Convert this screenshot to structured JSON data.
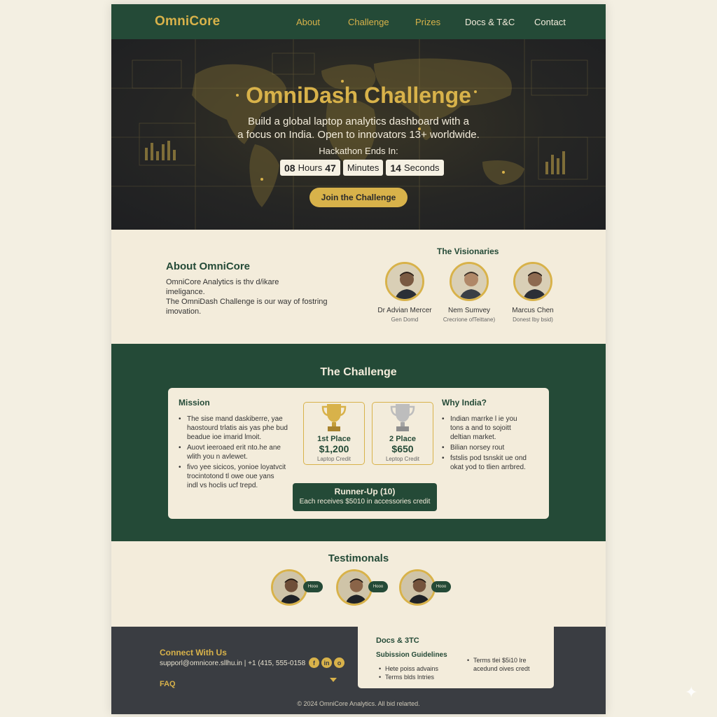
{
  "nav": {
    "logo": "OmniCore",
    "links": [
      {
        "label": "About"
      },
      {
        "label": "Challenge"
      },
      {
        "label": "Prizes"
      },
      {
        "label": "Docs & T&C"
      },
      {
        "label": "Contact"
      }
    ]
  },
  "hero": {
    "title": "OmniDash Challenge",
    "subtitle_line1": "Build a global laptop analytics dashboard with a",
    "subtitle_line2": "a focus on India. Open to innovators 13+ worldwide.",
    "ends_label": "Hackathon Ends In:",
    "countdown": {
      "hours_value": "08",
      "hours_unit": "Hours",
      "minutes_value": "47",
      "minutes_unit": "Minutes",
      "seconds_value": "14",
      "seconds_unit": "Seconds"
    },
    "cta": "Join the Challenge"
  },
  "about": {
    "title": "About OmniCore",
    "text_line1": "OmniCore Analytics is thv d/ikare",
    "text_line2": "imeligance.",
    "text_line3": "The OmniDash Challenge is our way of fostring",
    "text_line4": "imovation.",
    "visionaries_title": "The Visionaries",
    "visionaries": [
      {
        "name": "Dr Advian Mercer",
        "role": "Gen Domd"
      },
      {
        "name": "Nem Sumvey",
        "role": "Crecrione ofTeittane)"
      },
      {
        "name": "Marcus Chen",
        "role": "Donest Iby bsid)"
      }
    ]
  },
  "challenge": {
    "title": "The Challenge",
    "mission_title": "Mission",
    "mission_bullets": [
      [
        "The sise mand daskiberre, yae",
        "haostourd trlatis ais yas phe bud",
        "beadue ioe imarid lmoit."
      ],
      [
        "Auovt ieeroaed erit nto.he ane",
        "wlith you n avlewet."
      ],
      [
        "fivo yee sicicos, yonioe loyatvcit",
        "trocintotond tl owe oue yans",
        "indl vs hoclis ucf trepd."
      ]
    ],
    "prizes": [
      {
        "place": "1st Place",
        "amount": "$1,200",
        "credit": "Laptop Credit",
        "color": "#d8b24a"
      },
      {
        "place": "2 Place",
        "amount": "$650",
        "credit": "Leptop Credit",
        "color": "#b8b8b8"
      }
    ],
    "why_title": "Why India?",
    "why_bullets": [
      [
        "Indian marrke l ie you",
        "tons a and to sojoitt",
        "deltian market."
      ],
      [
        "Bilian norsey rout"
      ],
      [
        "fstslis pod tsnskit ue ond",
        "okat yod to tlien arrbred."
      ]
    ],
    "runner_title": "Runner-Up (10)",
    "runner_desc": "Each receives $5010 in accessories credit"
  },
  "testimonials": {
    "title": "Testimonals",
    "badges": [
      "Hooo",
      "Hooo",
      "Hooo"
    ]
  },
  "footer": {
    "connect_title": "Connect With Us",
    "contact_line": "supporl@omnicore.sllhu.in | +1 (415, 555-0158",
    "faq": "FAQ",
    "socials": [
      "f",
      "in",
      "o"
    ],
    "docs_title": "Docs & 3TC",
    "submission_title": "Subission Guidelines",
    "submission_bullets": [
      "Hete poiss advains",
      "Terms blds lntries"
    ],
    "terms_bullets": [
      "Terms tlei $5i10 lre",
      "acedund oives credt"
    ],
    "copyright": "© 2024 OmniCore Analytics. All bid relarted."
  },
  "colors": {
    "primary_green": "#244a37",
    "gold": "#d8b24a",
    "cream": "#f3ecdb",
    "footer_dark": "#3a3d42"
  },
  "icons": [
    "trophy-gold-icon",
    "trophy-silver-icon",
    "facebook-icon",
    "linkedin-icon",
    "instagram-icon",
    "chevron-down-icon",
    "sparkle-icon"
  ]
}
